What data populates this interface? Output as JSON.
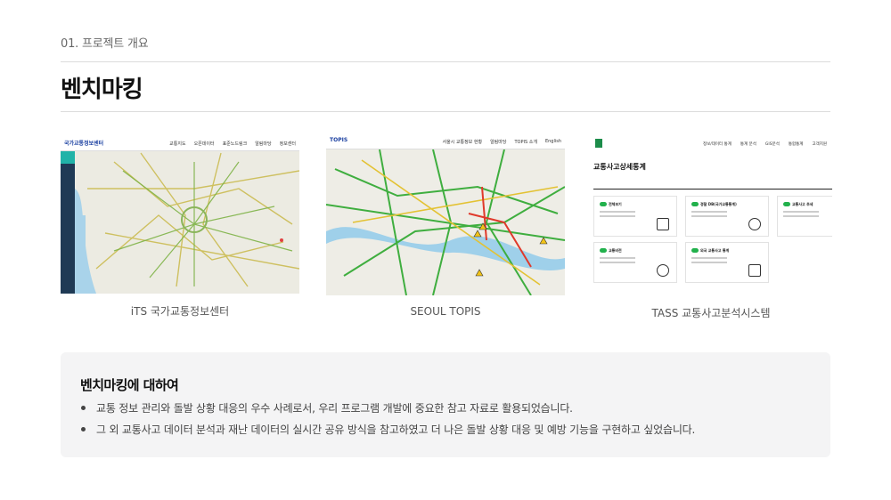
{
  "header": {
    "section": "01. 프로젝트 개요",
    "title": "벤치마킹"
  },
  "benchmarks": [
    {
      "caption": "iTS 국가교통정보센터",
      "brand": "국가교통정보센터",
      "nav": [
        "교통지도",
        "오픈데이터",
        "표준노드링크",
        "알림마당",
        "정보센터"
      ]
    },
    {
      "caption": "SEOUL TOPIS",
      "brand": "TOPIS",
      "nav": [
        "서울시 교통정보 현황",
        "알림마당",
        "TOPIS 소개",
        "English"
      ]
    },
    {
      "caption": "TASS 교통사고분석시스템",
      "heading": "교통사고상세통계",
      "nav": [
        "정보/데이터 통계",
        "통계 분석",
        "GIS분석",
        "통합통계",
        "고객지원"
      ],
      "cards": [
        "전체보기",
        "경찰 DB(국가교통통계)",
        "교통사고 추세",
        "교통비전",
        "외국 교통사고 통계"
      ]
    }
  ],
  "info": {
    "title": "벤치마킹에 대하여",
    "bullets": [
      "교통 정보 관리와 돌발 상황 대응의 우수 사례로서, 우리 프로그램 개발에 중요한 참고 자료로 활용되었습니다.",
      "그 외 교통사고 데이터 분석과 재난 데이터의 실시간 공유 방식을 참고하였고 더 나은 돌발 상황 대응 및 예방 기능을 구현하고 싶었습니다."
    ]
  }
}
